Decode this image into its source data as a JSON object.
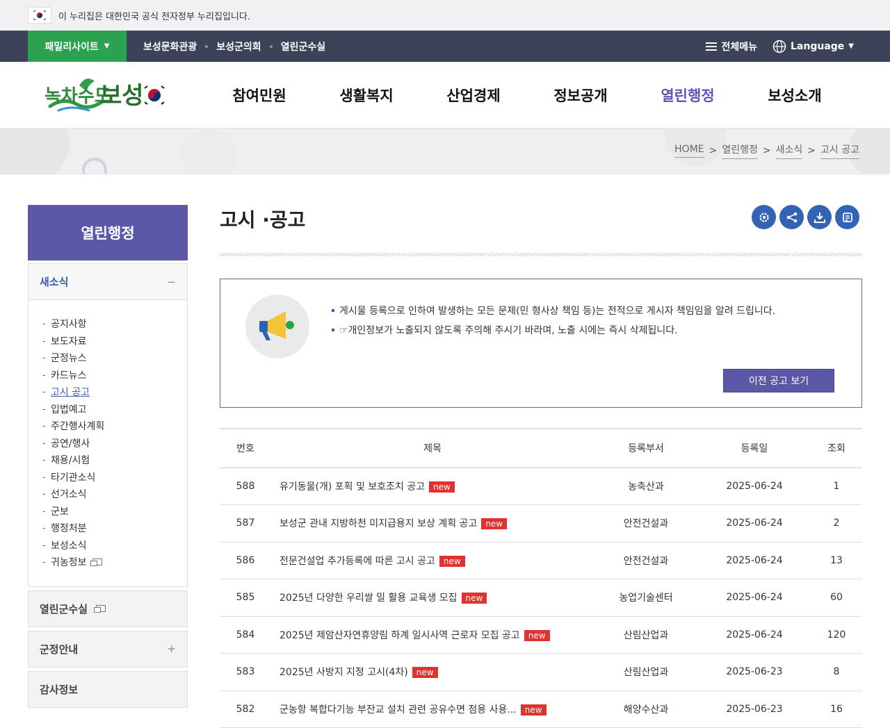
{
  "gov_banner": {
    "text": "이 누리집은 대한민국 공식 전자정부 누리집입니다."
  },
  "util": {
    "family_site": "패밀리사이트",
    "links": [
      "보성문화관광",
      "보성군의회",
      "열린군수실"
    ],
    "all_menu": "전체메뉴",
    "language": "Language"
  },
  "logo": {
    "text": "녹차수도 보성"
  },
  "gnb": [
    "참여민원",
    "생활복지",
    "산업경제",
    "정보공개",
    "열린행정",
    "보성소개"
  ],
  "gnb_active_index": 4,
  "breadcrumb": [
    "HOME",
    "열린행정",
    "새소식",
    "고시 공고"
  ],
  "lnb": {
    "title": "열린행정",
    "open_section": "새소식",
    "items": [
      "공지사항",
      "보도자료",
      "군정뉴스",
      "카드뉴스",
      "고시 공고",
      "입법예고",
      "주간행사계획",
      "공연/행사",
      "채용/시험",
      "타기관소식",
      "선거소식",
      "군보",
      "행정처분",
      "보성소식",
      "귀농정보"
    ],
    "active_index": 4,
    "sections": [
      "열린군수실",
      "군정안내",
      "감사정보"
    ]
  },
  "page": {
    "title": "고시 ·공고"
  },
  "notice": {
    "lines": [
      "게시물 등록으로 인하여 발생하는 모든 문제(민 형사상 책임 등)는 전적으로 게시자 책임임을 알려 드립니다.",
      "☞개인정보가 노출되지 않도록 주의해 주시기 바라며, 노출 시에는 즉시 삭제됩니다."
    ],
    "prev_button": "이전 공고 보기"
  },
  "table": {
    "headers": [
      "번호",
      "제목",
      "등록부서",
      "등록일",
      "조회"
    ],
    "new_label": "new",
    "rows": [
      {
        "no": "588",
        "title": "유기동물(개) 포획 및 보호조치 공고",
        "dept": "농축산과",
        "date": "2025-06-24",
        "views": "1"
      },
      {
        "no": "587",
        "title": "보성군 관내 지방하천 미지급용지 보상 계획 공고",
        "dept": "안전건설과",
        "date": "2025-06-24",
        "views": "2"
      },
      {
        "no": "586",
        "title": "전문건설업 추가등록에 따른 고시 공고",
        "dept": "안전건설과",
        "date": "2025-06-24",
        "views": "13"
      },
      {
        "no": "585",
        "title": "2025년 다양한 우리쌀 밀 활용 교육생 모집",
        "dept": "농업기술센터",
        "date": "2025-06-24",
        "views": "60"
      },
      {
        "no": "584",
        "title": "2025년 제암산자연휴양림 하계 일시사역 근로자 모집 공고",
        "dept": "산림산업과",
        "date": "2025-06-24",
        "views": "120"
      },
      {
        "no": "583",
        "title": "2025년 사방지 지정 고시(4차)",
        "dept": "산림산업과",
        "date": "2025-06-23",
        "views": "8"
      },
      {
        "no": "582",
        "title": "군농항 복합다기능 부잔교 설치 관련 공유수면 점용 사용...",
        "dept": "해양수산과",
        "date": "2025-06-23",
        "views": "16"
      }
    ]
  },
  "colors": {
    "util_bar": "#3c4257",
    "family_green": "#2aa24f",
    "lnb_purple": "#5b58a8",
    "tool_blue": "#3463b6",
    "new_red": "#e0332f"
  }
}
